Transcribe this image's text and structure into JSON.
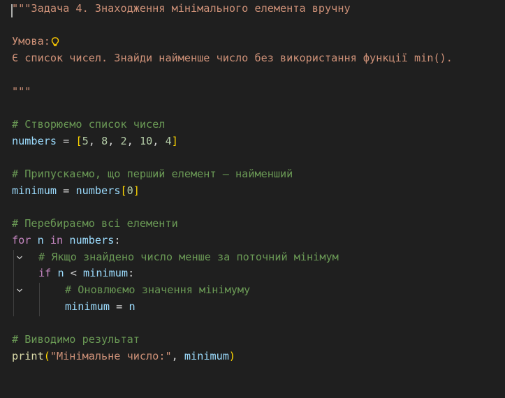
{
  "code": {
    "docstring_title": "\"\"\"Задача 4. Знаходження мінімального елемента вручну",
    "condition_label": "Умова:",
    "condition_text": "Є список чисел. Знайди найменше число без використання функції min().",
    "docstring_close": "\"\"\"",
    "comment_create": "# Створюємо список чисел",
    "var_numbers": "numbers",
    "op_assign": " = ",
    "bracket_open": "[",
    "list_values": [
      "5",
      "8",
      "2",
      "10",
      "4"
    ],
    "bracket_close": "]",
    "comment_assume": "# Припускаємо, що перший елемент — найменший",
    "var_minimum": "minimum",
    "index_zero": "0",
    "comment_iterate": "# Перебираємо всі елементи",
    "kw_for": "for",
    "var_n": "n",
    "kw_in": "in",
    "colon": ":",
    "comment_if_found": "# Якщо знайдено число менше за поточний мінімум",
    "kw_if": "if",
    "op_lt": " < ",
    "comment_update": "# Оновлюємо значення мінімуму",
    "comment_output": "# Виводимо результат",
    "fn_print": "print",
    "print_string": "\"Мінімальне число:\""
  },
  "icons": {
    "lightbulb": "lightbulb-icon",
    "fold": "chevron-down-icon"
  },
  "colors": {
    "background": "#1f1f1f",
    "string": "#ce9178",
    "comment": "#6a9955",
    "keyword": "#c586c0",
    "function": "#dcdcaa",
    "variable": "#9cdcfe",
    "number": "#b5cea8",
    "bracket_level1": "#ffd700",
    "bracket_level2": "#da70d6"
  }
}
